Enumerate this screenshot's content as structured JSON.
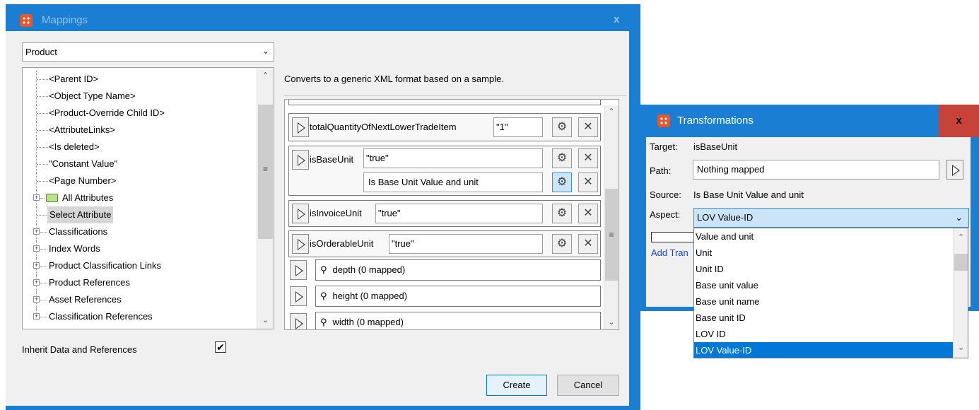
{
  "mappings": {
    "title": "Mappings",
    "close": "x",
    "object_select": "Product",
    "tree": [
      {
        "label": "<Parent ID>",
        "expandable": false,
        "selected": false
      },
      {
        "label": "<Object Type Name>",
        "expandable": false,
        "selected": false
      },
      {
        "label": "<Product-Override Child ID>",
        "expandable": false,
        "selected": false
      },
      {
        "label": "<AttributeLinks>",
        "expandable": false,
        "selected": false
      },
      {
        "label": "<Is deleted>",
        "expandable": false,
        "selected": false
      },
      {
        "label": "\"Constant Value\"",
        "expandable": false,
        "selected": false
      },
      {
        "label": "<Page Number>",
        "expandable": false,
        "selected": false
      },
      {
        "label": "All Attributes",
        "expandable": true,
        "folder": true,
        "selected": false
      },
      {
        "label": "Select Attribute",
        "expandable": false,
        "selected": true
      },
      {
        "label": "Classifications",
        "expandable": true,
        "selected": false
      },
      {
        "label": "Index Words",
        "expandable": true,
        "selected": false
      },
      {
        "label": "Product Classification Links",
        "expandable": true,
        "selected": false
      },
      {
        "label": "Product References",
        "expandable": true,
        "selected": false
      },
      {
        "label": "Asset References",
        "expandable": true,
        "selected": false
      },
      {
        "label": "Classification References",
        "expandable": true,
        "selected": false
      }
    ],
    "description": "Converts to a generic XML format based on a sample.",
    "rows": [
      {
        "name": "totalQuantityOfNextLowerTradeItem",
        "value": "\"1\""
      },
      {
        "name": "isBaseUnit",
        "value": "\"true\"",
        "value2": "Is Base Unit Value and unit"
      },
      {
        "name": "isInvoiceUnit",
        "value": "\"true\""
      },
      {
        "name": "isOrderableUnit",
        "value": "\"true\""
      }
    ],
    "groups": [
      {
        "label": "depth (0 mapped)"
      },
      {
        "label": "height (0 mapped)"
      },
      {
        "label": "width (0 mapped)"
      }
    ],
    "inherit_label": "Inherit Data and References",
    "inherit_checked": "✔",
    "create_label": "Create",
    "cancel_label": "Cancel"
  },
  "transformations": {
    "title": "Transformations",
    "close": "x",
    "target_label": "Target:",
    "target_value": "isBaseUnit",
    "path_label": "Path:",
    "path_value": "Nothing mapped",
    "source_label": "Source:",
    "source_value": "Is Base Unit Value and unit",
    "aspect_label": "Aspect:",
    "aspect_value": "LOV Value-ID",
    "add_link": "Add Tran",
    "aspect_options": [
      "Value and unit",
      "Unit",
      "Unit ID",
      "Base unit value",
      "Base unit name",
      "Base unit ID",
      "LOV ID",
      "LOV Value-ID"
    ],
    "aspect_selected_index": 7
  },
  "icons": {
    "app": "stibo-app-icon",
    "chevron": "chevron-down-icon",
    "play": "play-icon",
    "transform": "transform-icon",
    "remove": "remove-x-icon",
    "pin": "pin-icon",
    "folder": "folder-icon"
  }
}
